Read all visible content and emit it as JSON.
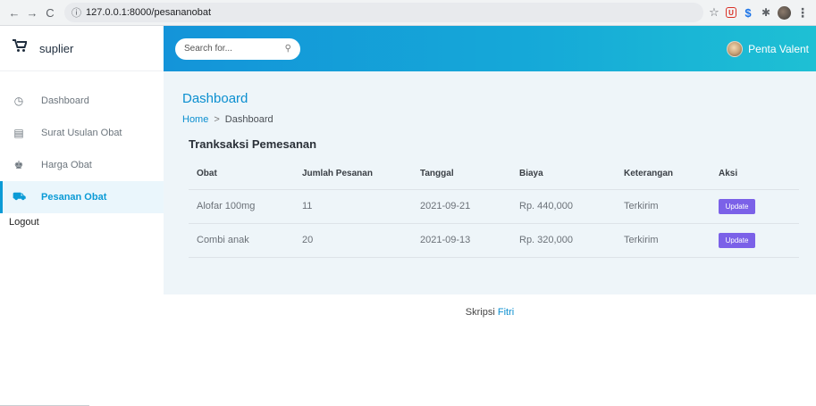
{
  "browser": {
    "url": "127.0.0.1:8000/pesananobat",
    "back_glyph": "←",
    "forward_glyph": "→",
    "reload_glyph": "C",
    "info_glyph": "ⓘ"
  },
  "sidebar": {
    "brand_icon": "cart-icon",
    "brand_name": "suplier",
    "items": [
      {
        "icon": "clock-icon",
        "glyph": "◷",
        "label": "Dashboard",
        "active": false
      },
      {
        "icon": "document-icon",
        "glyph": "▤",
        "label": "Surat Usulan Obat",
        "active": false
      },
      {
        "icon": "user-icon",
        "glyph": "♚",
        "label": "Harga Obat",
        "active": false
      },
      {
        "icon": "truck-icon",
        "glyph": "⛟",
        "label": "Pesanan Obat",
        "active": true
      }
    ],
    "logout_label": "Logout"
  },
  "topbar": {
    "search_placeholder": "Search for...",
    "search_glyph": "⚲",
    "user_name": "Penta Valent"
  },
  "content": {
    "page_title": "Dashboard",
    "breadcrumb_home": "Home",
    "breadcrumb_sep": ">",
    "breadcrumb_current": "Dashboard",
    "card_title": "Tranksaksi Pemesanan",
    "columns": [
      "Obat",
      "Jumlah Pesanan",
      "Tanggal",
      "Biaya",
      "Keterangan",
      "Aksi"
    ],
    "rows": [
      {
        "obat": "Alofar 100mg",
        "jumlah": "11",
        "tanggal": "2021-09-21",
        "biaya": "Rp. 440,000",
        "keterangan": "Terkirim",
        "aksi": "Update"
      },
      {
        "obat": "Combi anak",
        "jumlah": "20",
        "tanggal": "2021-09-13",
        "biaya": "Rp. 320,000",
        "keterangan": "Terkirim",
        "aksi": "Update"
      }
    ]
  },
  "footer": {
    "prefix": "Skripsi",
    "author": "Fitri"
  },
  "colors": {
    "accent": "#0b8fd0",
    "topbar_start": "#1494d9",
    "topbar_end": "#1ec0d4",
    "update_button": "#7b61e8",
    "content_bg": "#eef5f9"
  }
}
